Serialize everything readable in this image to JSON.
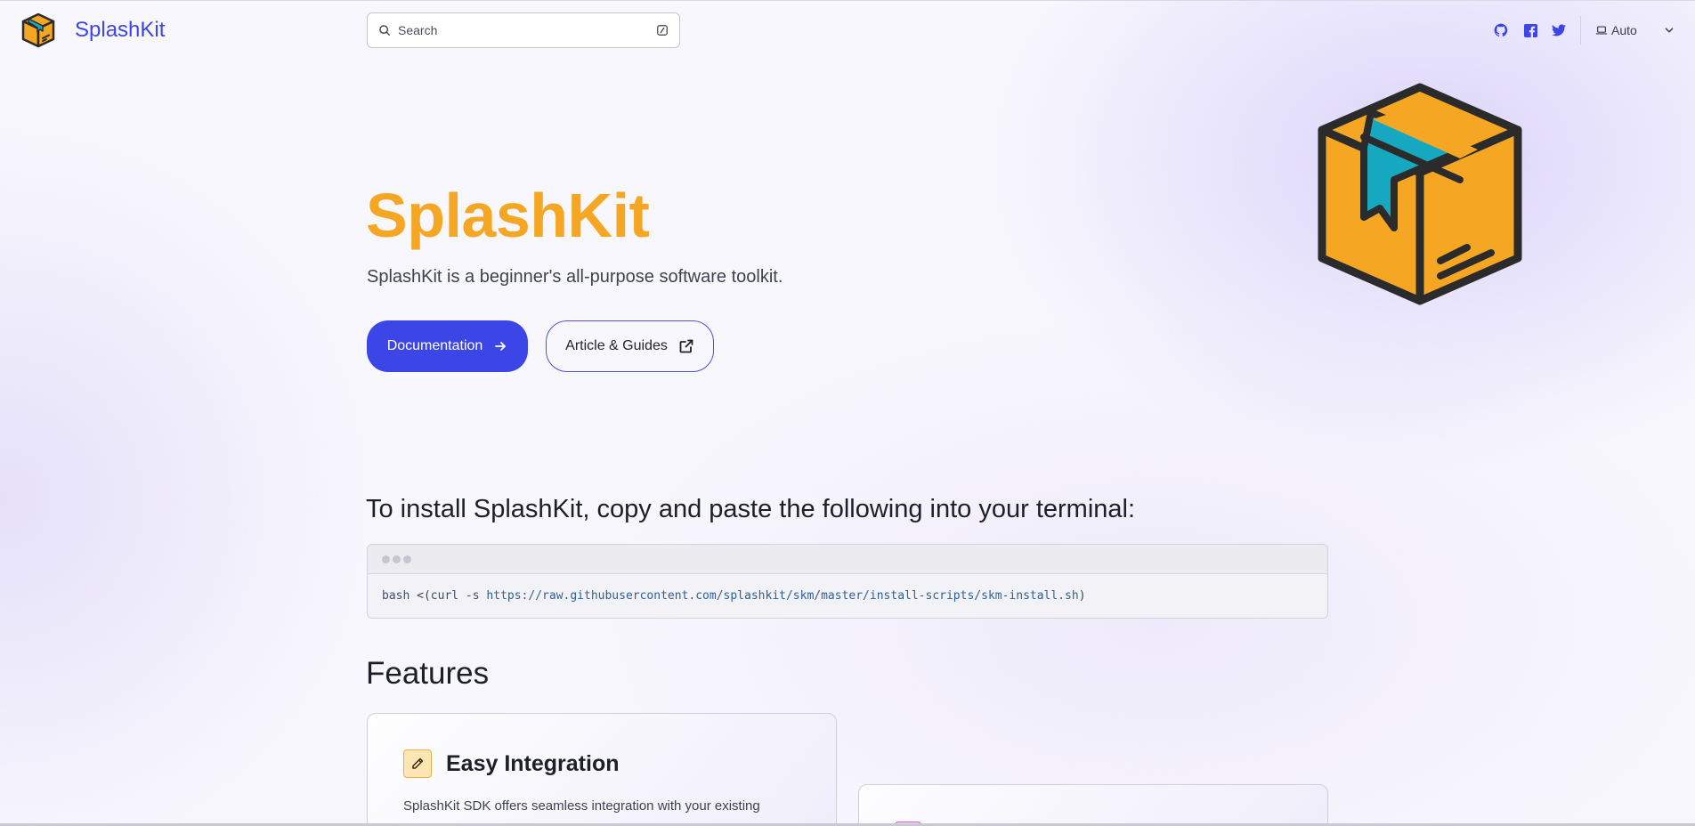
{
  "header": {
    "brand_name": "SplashKit",
    "search": {
      "placeholder": "Search"
    },
    "social": [
      {
        "name": "GitHub",
        "icon": "github-icon"
      },
      {
        "name": "Facebook",
        "icon": "facebook-icon"
      },
      {
        "name": "Twitter",
        "icon": "twitter-icon"
      }
    ],
    "theme_select": {
      "value": "Auto",
      "icon": "laptop-icon"
    }
  },
  "hero": {
    "title": "SplashKit",
    "tagline": "SplashKit is a beginner's all-purpose software toolkit.",
    "primary_button": "Documentation",
    "secondary_button": "Article & Guides",
    "accent_color": "#3c46e6",
    "title_color": "#f5a623"
  },
  "install": {
    "heading": "To install SplashKit, copy and paste the following into your terminal:",
    "command": "bash",
    "prefix": "<(",
    "curl": "curl -s",
    "url": "https://raw.githubusercontent.com/splashkit/skm/master/install-scripts/skm-install.sh",
    "suffix": ")"
  },
  "features": {
    "heading": "Features",
    "cards": [
      {
        "title": "Easy Integration",
        "icon": "pencil-icon",
        "description": "SplashKit SDK offers seamless integration with your existing"
      }
    ]
  }
}
